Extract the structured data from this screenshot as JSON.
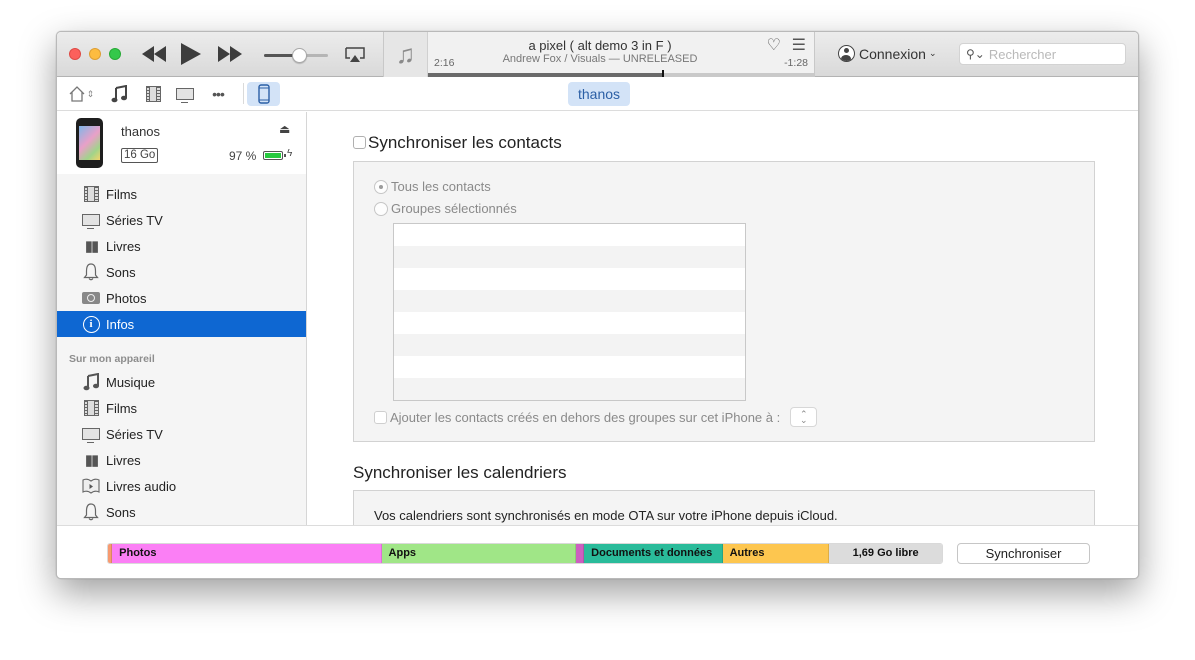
{
  "toolbar": {
    "window_controls": [
      "close",
      "minimize",
      "maximize"
    ],
    "transport": {
      "rewind_icon": "rewind-icon",
      "play_icon": "play-icon",
      "forward_icon": "fast-forward-icon"
    },
    "volume_level": 0.55,
    "airplay_icon": "airplay-icon",
    "now_playing": {
      "artwork_icon": "music-note-icon",
      "title": "a pixel ( alt demo 3 in F )",
      "artist": "Andrew Fox / Visuals — UNRELEASED",
      "elapsed": "2:16",
      "remaining": "-1:28",
      "progress": 0.61,
      "heart_glyph": "♡",
      "list_glyph": "☰"
    },
    "account_label": "Connexion",
    "search_placeholder": "Rechercher",
    "search_value": ""
  },
  "navbar": {
    "items": [
      {
        "name": "home",
        "glyph": "⌂"
      },
      {
        "name": "music",
        "glyph": "♫"
      },
      {
        "name": "movies",
        "glyph": "film"
      },
      {
        "name": "tv",
        "glyph": "tv"
      },
      {
        "name": "more",
        "glyph": "•••"
      },
      {
        "name": "device",
        "glyph": "iphone"
      }
    ],
    "device_chip": "thanos"
  },
  "sidebar": {
    "device": {
      "name": "thanos",
      "capacity": "16 Go",
      "battery_text": "97 %",
      "battery_level": 0.97,
      "eject_glyph": "⏏"
    },
    "settings_items": [
      {
        "label": "Films",
        "icon": "film-icon"
      },
      {
        "label": "Séries TV",
        "icon": "tv-icon"
      },
      {
        "label": "Livres",
        "icon": "book-icon"
      },
      {
        "label": "Sons",
        "icon": "bell-icon"
      },
      {
        "label": "Photos",
        "icon": "camera-icon"
      },
      {
        "label": "Infos",
        "icon": "info-icon",
        "active": true
      }
    ],
    "section_label": "Sur mon appareil",
    "device_items": [
      {
        "label": "Musique",
        "icon": "music-note-icon"
      },
      {
        "label": "Films",
        "icon": "film-icon"
      },
      {
        "label": "Séries TV",
        "icon": "tv-icon"
      },
      {
        "label": "Livres",
        "icon": "book-icon"
      },
      {
        "label": "Livres audio",
        "icon": "audiobook-icon"
      },
      {
        "label": "Sons",
        "icon": "bell-icon"
      }
    ]
  },
  "main": {
    "contacts": {
      "title": "Synchroniser les contacts",
      "checked": false,
      "radio_all": "Tous les contacts",
      "radio_groups": "Groupes sélectionnés",
      "add_contacts_label": "Ajouter les contacts créés en dehors des groupes sur cet iPhone à :",
      "group_rows": 8
    },
    "calendars": {
      "title": "Synchroniser les calendriers",
      "message": "Vos calendriers sont synchronisés en mode OTA sur votre iPhone depuis iCloud."
    }
  },
  "footer": {
    "storage": [
      {
        "label": "",
        "share": 0.5,
        "color": "#f79a6f"
      },
      {
        "label": "Photos",
        "share": 32.3,
        "color": "#fb7ff5"
      },
      {
        "label": "Apps",
        "share": 23.3,
        "color": "#a0e687"
      },
      {
        "label": "",
        "share": 1.0,
        "color": "#cc5fc0"
      },
      {
        "label": "Documents et données",
        "share": 16.6,
        "color": "#2abb9a"
      },
      {
        "label": "Autres",
        "share": 12.8,
        "color": "#fdc64f"
      },
      {
        "label": "1,69 Go libre",
        "share": 13.5,
        "color": "#dcdcdc",
        "free": true
      }
    ],
    "sync_label": "Synchroniser"
  }
}
